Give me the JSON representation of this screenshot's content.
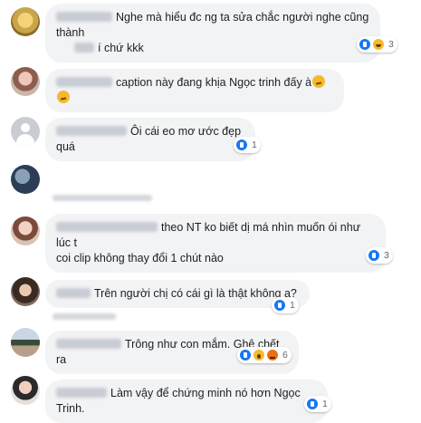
{
  "comments": [
    {
      "line1": "Nghe mà hiểu đc ng ta sửa chắc người nghe cũng thành",
      "line2": "í chứ kkk",
      "reactions": [
        "like",
        "haha"
      ],
      "count": "3"
    },
    {
      "line1": "caption này đang khịa Ngọc trinh đấy à",
      "emoji": [
        "thinking-face-emoji",
        "thinking-face-emoji"
      ]
    },
    {
      "line1": "Ôi cái eo mơ ước đẹp quá",
      "reactions": [
        "like"
      ],
      "count": "1"
    },
    {
      "line1": ""
    },
    {
      "line1": "theo NT ko biết dị má nhìn muốn ói như lúc t",
      "line2": "coi clip không thay đổi 1 chút nào",
      "reactions": [
        "like"
      ],
      "count": "3"
    },
    {
      "line1": "Trên người chị có cái gì là thật không ạ?",
      "reactions": [
        "like"
      ],
      "count": "1"
    },
    {
      "line1": "Trông như con mắm. Ghê chết ra",
      "reactions": [
        "like",
        "wow",
        "angry"
      ],
      "count": "6"
    },
    {
      "line1": "Làm vậy để chứng minh nó hơn Ngọc Trinh.",
      "reactions": [
        "like"
      ],
      "count": "1"
    }
  ],
  "colors": {
    "bubble": "#f2f3f5",
    "like": "#1877f2",
    "haha": "#f7b928",
    "angry": "#e9710f",
    "text": "#1c1e21",
    "meta": "#90949c"
  }
}
